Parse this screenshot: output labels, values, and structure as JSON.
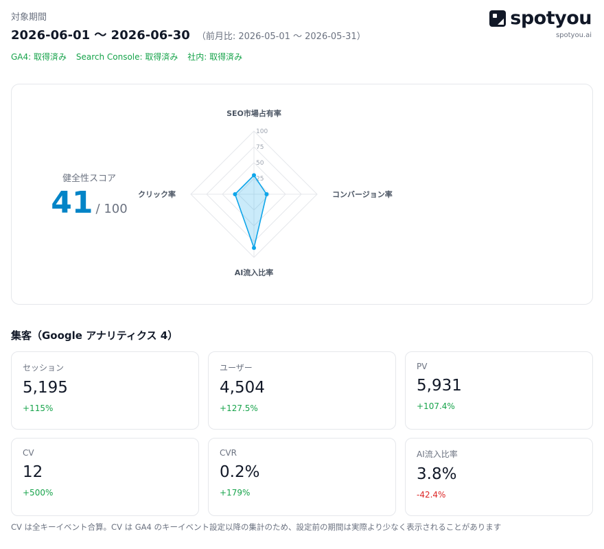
{
  "header": {
    "period_label": "対象期間",
    "period_range": "2026-06-01 〜 2026-06-30",
    "compare_text": "（前月比: 2026-05-01 〜 2026-05-31）",
    "sources": [
      "GA4: 取得済み",
      "Search Console: 取得済み",
      "社内: 取得済み"
    ]
  },
  "brand": {
    "name": "spotyou",
    "domain": "spotyou.ai",
    "icon": "spotyou-logo-icon"
  },
  "health": {
    "title": "健全性スコア",
    "score": "41",
    "max": "/ 100",
    "radar": {
      "axes": [
        "SEO市場占有率",
        "コンバージョン率",
        "AI流入比率",
        "クリック率"
      ],
      "ticks": [
        "25",
        "50",
        "75",
        "100"
      ],
      "values": [
        30,
        20,
        85,
        30
      ],
      "max": 100,
      "accent": "#0ea5e9"
    }
  },
  "ga_section": {
    "title": "集客（Google アナリティクス 4）",
    "metrics": [
      {
        "label": "セッション",
        "value": "5,195",
        "delta": "+115%",
        "trend": "up"
      },
      {
        "label": "ユーザー",
        "value": "4,504",
        "delta": "+127.5%",
        "trend": "up"
      },
      {
        "label": "PV",
        "value": "5,931",
        "delta": "+107.4%",
        "trend": "up"
      },
      {
        "label": "CV",
        "value": "12",
        "delta": "+500%",
        "trend": "up"
      },
      {
        "label": "CVR",
        "value": "0.2%",
        "delta": "+179%",
        "trend": "up"
      },
      {
        "label": "AI流入比率",
        "value": "3.8%",
        "delta": "-42.4%",
        "trend": "down"
      }
    ]
  },
  "footnote": "CV は全キーイベント合算。CV は GA4 のキーイベント設定以降の集計のため、設定前の期間は実際より少なく表示されることがあります",
  "colors": {
    "score": "#0284c7",
    "up": "#16a34a",
    "down": "#dc2626"
  }
}
